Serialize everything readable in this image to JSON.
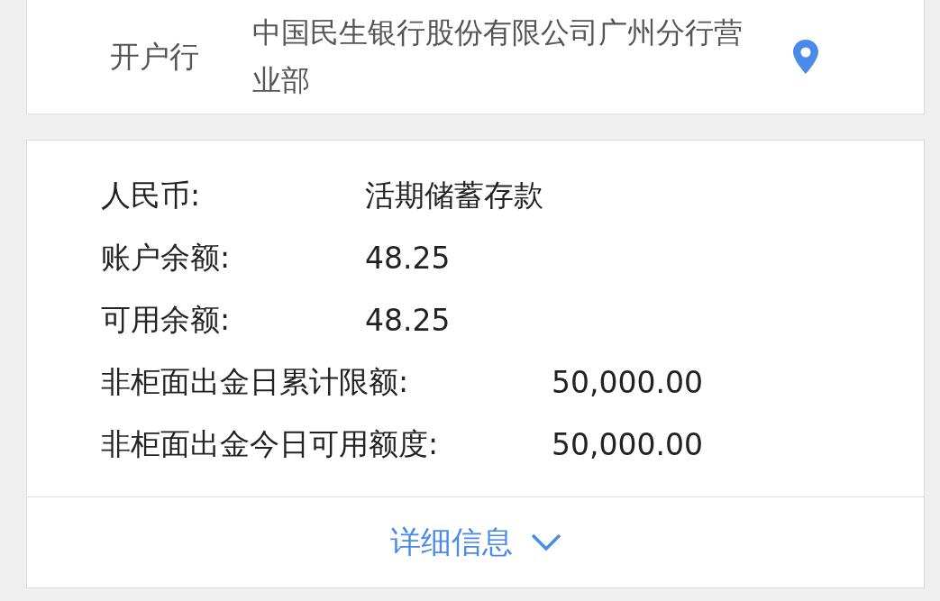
{
  "bank": {
    "label": "开户行",
    "value": "中国民生银行股份有限公司广州分行营业部"
  },
  "account": {
    "balances": [
      {
        "label": "人民币:",
        "value": "活期储蓄存款"
      },
      {
        "label": "账户余额:",
        "value": "48.25"
      },
      {
        "label": "可用余额:",
        "value": "48.25"
      }
    ],
    "limits": [
      {
        "label": "非柜面出金日累计限额:",
        "value": "50,000.00"
      },
      {
        "label": "非柜面出金今日可用额度:",
        "value": "50,000.00"
      }
    ],
    "details_link": "详细信息"
  }
}
